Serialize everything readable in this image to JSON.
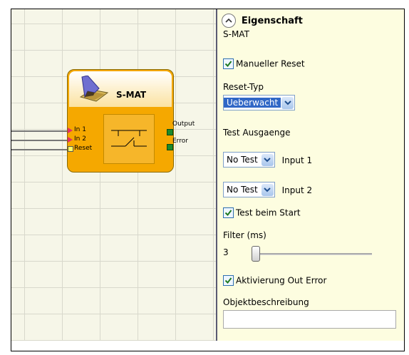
{
  "block": {
    "name": "S-MAT",
    "inputs": [
      "In 1",
      "In 2",
      "Reset"
    ],
    "outputs": [
      "Output",
      "Error"
    ]
  },
  "properties": {
    "header": "Eigenschaft",
    "subtitle": "S-MAT",
    "manual_reset": {
      "label": "Manueller Reset",
      "checked": true
    },
    "reset_type": {
      "label": "Reset-Typ",
      "value": "Ueberwacht"
    },
    "test_outputs": {
      "label": "Test Ausgaenge"
    },
    "input1": {
      "combo": "No Test",
      "label": "Input 1"
    },
    "input2": {
      "combo": "No Test",
      "label": "Input 2"
    },
    "test_on_start": {
      "label": "Test beim Start",
      "checked": true
    },
    "filter": {
      "label": "Filter (ms)",
      "value": "3"
    },
    "activate_error": {
      "label": "Aktivierung Out Error",
      "checked": true
    },
    "description": {
      "label": "Objektbeschreibung",
      "value": ""
    }
  },
  "icons": {
    "collapse": "chevron-up-icon",
    "dropdown": "chevron-down-icon",
    "check": "checkmark-icon",
    "mat": "safety-mat-icon"
  },
  "colors": {
    "block_fill": "#f5a800",
    "panel_bg": "#fdfde0",
    "grid_bg": "#f6f6e8",
    "selection": "#3067c6"
  }
}
